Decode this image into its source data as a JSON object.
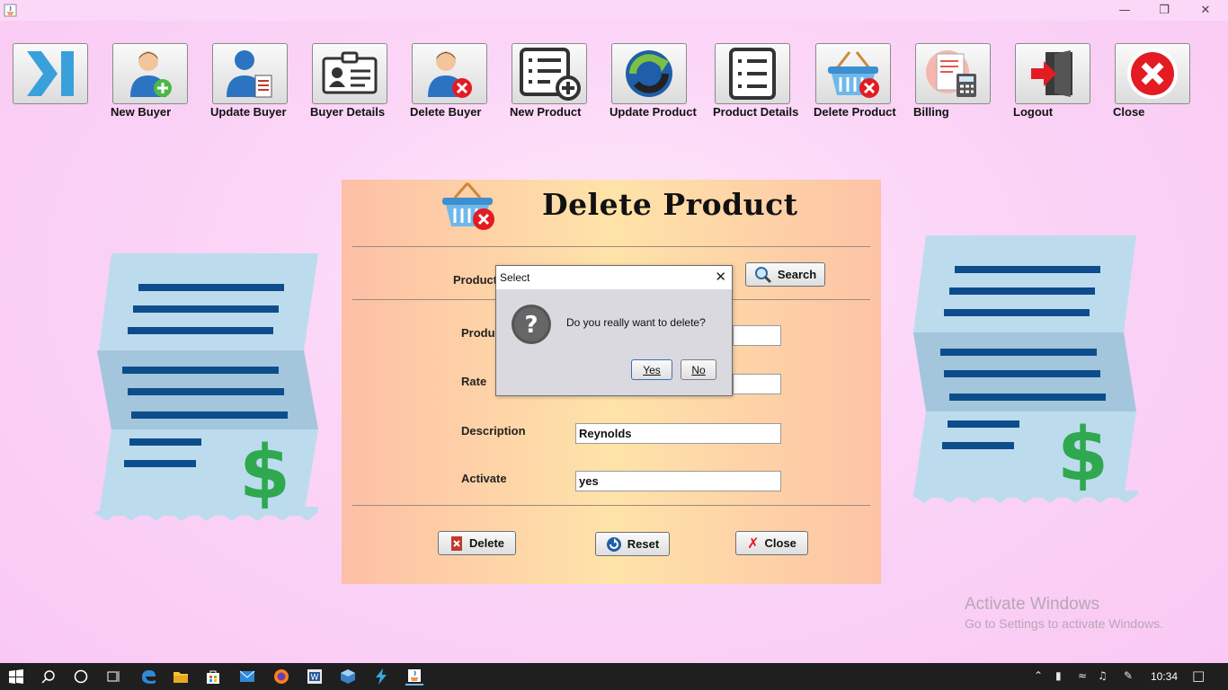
{
  "window": {
    "min_icon": "minimize-icon",
    "max_icon": "restore-icon",
    "close_icon": "close-icon"
  },
  "toolbar": [
    {
      "id": "collapse",
      "label": "",
      "icon": "collapse-arrow-icon"
    },
    {
      "id": "new-buyer",
      "label": "New Buyer",
      "icon": "add-user-icon"
    },
    {
      "id": "update-buyer",
      "label": "Update Buyer",
      "icon": "edit-user-icon"
    },
    {
      "id": "buyer-details",
      "label": "Buyer Details",
      "icon": "id-card-icon"
    },
    {
      "id": "delete-buyer",
      "label": "Delete Buyer",
      "icon": "remove-user-icon"
    },
    {
      "id": "new-product",
      "label": "New Product",
      "icon": "add-list-icon"
    },
    {
      "id": "update-product",
      "label": "Update Product",
      "icon": "refresh-icon"
    },
    {
      "id": "product-details",
      "label": "Product Details",
      "icon": "list-icon"
    },
    {
      "id": "delete-product",
      "label": "Delete Product",
      "icon": "basket-delete-icon"
    },
    {
      "id": "billing",
      "label": "Billing",
      "icon": "invoice-calculator-icon"
    },
    {
      "id": "logout",
      "label": "Logout",
      "icon": "exit-door-icon"
    },
    {
      "id": "close",
      "label": "Close",
      "icon": "close-circle-icon"
    }
  ],
  "panel": {
    "title": "Delete Product",
    "product_id_label": "Product",
    "search_label": "Search",
    "product_name_label": "Produc",
    "product_name_value": "",
    "rate_label": "Rate",
    "rate_value": "",
    "description_label": "Description",
    "description_value": "Reynolds",
    "activate_label": "Activate",
    "activate_value": "yes",
    "delete_label": "Delete",
    "reset_label": "Reset",
    "close_label": "Close"
  },
  "dialog": {
    "title": "Select",
    "message": "Do you really want to delete?",
    "yes_label": "Yes",
    "no_label": "No"
  },
  "watermark": {
    "line1": "Activate Windows",
    "line2": "Go to Settings to activate Windows."
  },
  "taskbar": {
    "clock": "10:34",
    "apps": [
      "start-icon",
      "search-icon",
      "cortana-icon",
      "task-view-icon",
      "edge-icon",
      "file-explorer-icon",
      "store-icon",
      "mail-icon",
      "firefox-icon",
      "word-icon",
      "virtualbox-icon",
      "app-icon",
      "java-app-icon"
    ]
  },
  "colors": {
    "background": "#fbd5f7",
    "panel_left": "#fdbfa6",
    "panel_mid": "#fee3a8",
    "receipt": "#bcdcee",
    "receipt_lines": "#0d4d8c",
    "dollar": "#2fa84f",
    "close_red": "#e31b23"
  }
}
